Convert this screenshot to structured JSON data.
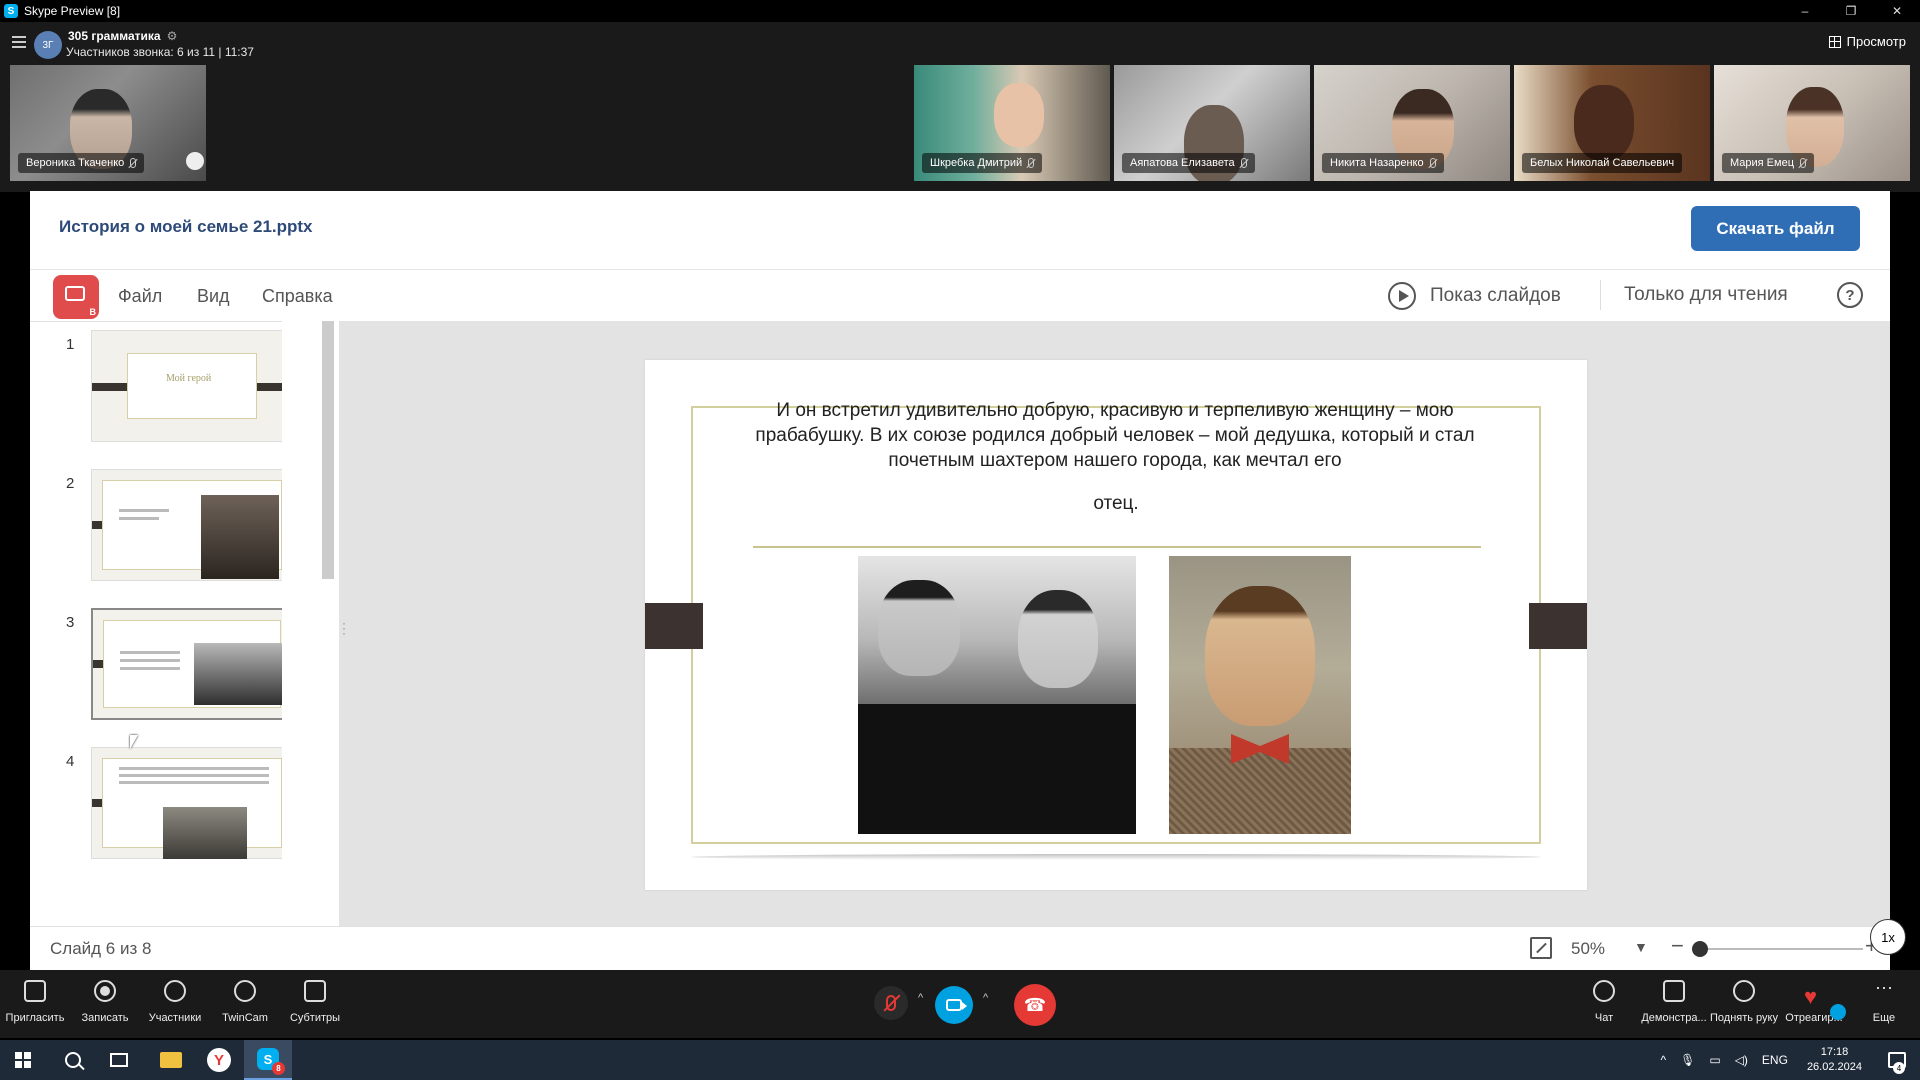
{
  "window": {
    "title": "Skype Preview [8]",
    "minimize": "–",
    "restore": "❐",
    "close": "✕"
  },
  "call": {
    "group_initials": "3Г",
    "group_name": "305 грамматика",
    "subtitle": "Участников звонка: 6 из 11 | 11:37",
    "view_label": "Просмотр",
    "self_tile": "Вероника Ткаченко",
    "participants": [
      "Шкребка Дмитрий",
      "Аяпатова Елизавета",
      "Никита Назаренко",
      "Белых Николай Савельевич",
      "Мария Емец"
    ]
  },
  "file": {
    "name": "История о моей семье 21.pptx",
    "download_label": "Скачать файл"
  },
  "viewer": {
    "menu": [
      "Файл",
      "Вид",
      "Справка"
    ],
    "slideshow_label": "Показ слайдов",
    "readonly_label": "Только для чтения",
    "help": "?",
    "thumb_numbers": [
      "1",
      "2",
      "3",
      "4"
    ],
    "thumb1_caption": "Мой герой",
    "slide_count": "Слайд 6 из 8",
    "zoom": "50%",
    "zoom_level": 0.1,
    "speed": "1x"
  },
  "slide": {
    "text": "И он встретил удивительно добрую, красивую и терпеливую женщину – мою прабабушку. В их союзе родился добрый человек – мой дедушка, который и стал почетным шахтером нашего города, как мечтал его",
    "text_end": "отец."
  },
  "controls": {
    "left": [
      "Пригласить",
      "Записать",
      "Участники",
      "TwinCam",
      "Субтитры"
    ],
    "right": [
      "Чат",
      "Демонстра...",
      "Поднять руку",
      "Отреагир...",
      "Еще"
    ]
  },
  "taskbar": {
    "lang": "ENG",
    "time": "17:18",
    "date": "26.02.2024",
    "skype_badge": "8",
    "notifications": "4"
  },
  "colors": {
    "accent": "#2f6eb5",
    "hangup": "#e53935",
    "camera": "#00a1e0",
    "title_text": "#2e4a78"
  }
}
